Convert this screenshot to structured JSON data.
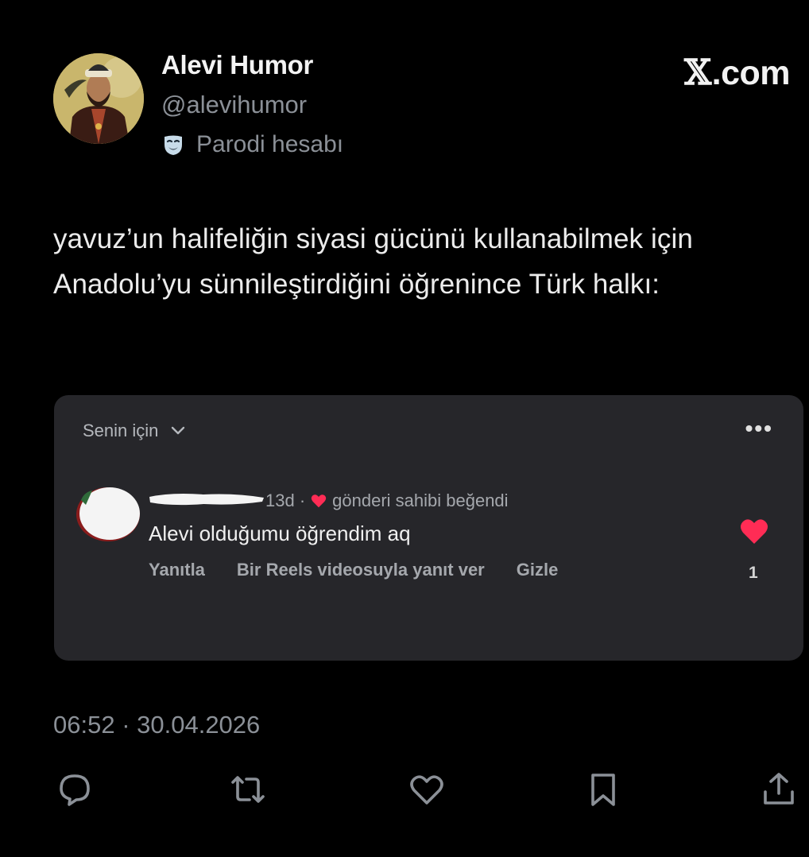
{
  "author": {
    "display_name": "Alevi Humor",
    "handle": "@alevihumor",
    "parody_label": "Parodi hesabı"
  },
  "brand": {
    "logo_x": "𝕏",
    "logo_text": ".com"
  },
  "tweet": {
    "text": "yavuz’un halifeliğin siyasi gücünü kullanabilmek için Anadolu’yu sünnileştirdiğini öğrenince Türk halkı:",
    "timestamp": "06:52 · 30.04.2026"
  },
  "embedded_card": {
    "header_label": "Senin için",
    "more_label": "•••",
    "comment": {
      "age": "13d ·",
      "liked_by_author": "gönderi sahibi beğendi",
      "text": "Alevi olduğumu öğrendim aq",
      "reply_label": "Yanıtla",
      "reels_reply_label": "Bir Reels videosuyla yanıt ver",
      "hide_label": "Gizle",
      "like_count": "1"
    }
  },
  "action_bar": {
    "icons": [
      "reply-icon",
      "retweet-icon",
      "like-icon",
      "bookmark-icon",
      "share-icon"
    ]
  },
  "colors": {
    "background": "#000000",
    "card": "#26262a",
    "muted_text": "#8b9097",
    "heart_red": "#ff2c55"
  }
}
